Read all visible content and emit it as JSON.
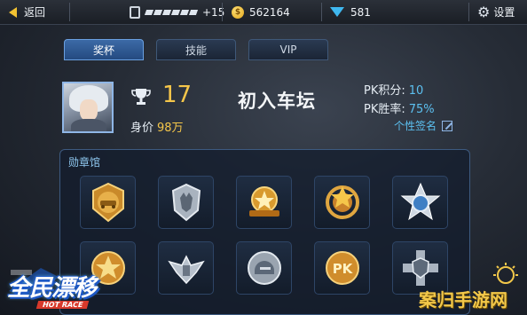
{
  "topbar": {
    "back_label": "返回",
    "fuel_value": "+15",
    "coins": "562164",
    "gems": "581",
    "settings_label": "设置"
  },
  "tabs": [
    {
      "label": "奖杯",
      "active": true
    },
    {
      "label": "技能",
      "active": false
    },
    {
      "label": "VIP",
      "active": false
    }
  ],
  "profile": {
    "trophy_count": "17",
    "worth_label": "身价",
    "worth_value": "98万",
    "rank_title": "初入车坛",
    "pk_score_label": "PK积分:",
    "pk_score_value": "10",
    "pk_winrate_label": "PK胜率:",
    "pk_winrate_value": "75%",
    "signature_label": "个性签名"
  },
  "medal_hall": {
    "title": "勋章馆",
    "medals": [
      {
        "icon": "gold-car-medal-icon"
      },
      {
        "icon": "silver-wolf-medal-icon"
      },
      {
        "icon": "gold-star-ribbon-medal-icon"
      },
      {
        "icon": "gold-star-wreath-medal-icon"
      },
      {
        "icon": "silver-star-ring-medal-icon"
      },
      {
        "icon": "gold-flag-medal-icon"
      },
      {
        "icon": "silver-wings-medal-icon"
      },
      {
        "icon": "silver-helmet-medal-icon"
      },
      {
        "icon": "gold-pk-medal-icon"
      },
      {
        "icon": "silver-cross-shield-medal-icon"
      }
    ]
  },
  "logo": {
    "title": "全民漂移",
    "subtitle": "HOT RACE"
  },
  "watermark": {
    "text": "案归手游网"
  },
  "colors": {
    "gold": "#f5c64a",
    "blue_text": "#5cc0f0",
    "tab_active": "#3c6aa6"
  }
}
